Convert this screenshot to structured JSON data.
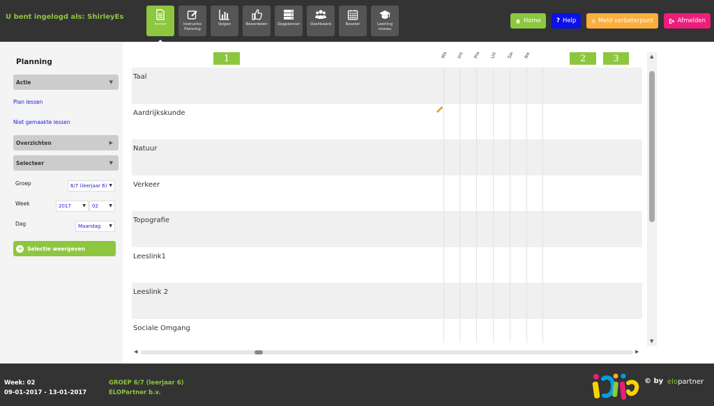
{
  "header": {
    "logged_in": "U bent ingelogd als: ShirleyEs",
    "nav": [
      {
        "label": "Invoer",
        "icon": "file-icon",
        "active": true
      },
      {
        "label": "Instructie Planning",
        "icon": "edit-icon",
        "active": false
      },
      {
        "label": "Volgen",
        "icon": "bar-chart-icon",
        "active": false
      },
      {
        "label": "Beoordelen",
        "icon": "thumbs-up-icon",
        "active": false
      },
      {
        "label": "Dagplanner",
        "icon": "server-icon",
        "active": false
      },
      {
        "label": "Dashboard",
        "icon": "users-icon",
        "active": false
      },
      {
        "label": "Rooster",
        "icon": "calendar-icon",
        "active": false
      },
      {
        "label": "Leerling niveau",
        "icon": "graduation-cap-icon",
        "active": false
      }
    ],
    "buttons": {
      "home": "Home",
      "help": "Help",
      "meld": "Meld verbeterpunt",
      "afmelden": "Afmelden"
    }
  },
  "sidebar": {
    "title": "Planning",
    "actie": "Actie",
    "plan_lessen": "Plan lessen",
    "niet_gemaakte": "Niet gemaakte lessen",
    "overzichten": "Overzichten",
    "selecteer": "Selecteer",
    "groep_label": "Groep",
    "groep_value": "6/7 (leerjaar 6)",
    "week_label": "Week",
    "week_year": "2017",
    "week_number": "02",
    "dag_label": "Dag",
    "dag_value": "Maandag",
    "selectie_btn": "Selectie weergeven"
  },
  "grid": {
    "group_numbers": [
      "1",
      "2",
      "3"
    ],
    "columns": [
      "Mate",
      "Instr.",
      "Plan.",
      "Uitv.",
      "Sam.",
      "Naki."
    ],
    "rows": [
      "Taal",
      "Aardrijkskunde",
      "Natuur",
      "Verkeer",
      "Topografie",
      "Leeslink1",
      "Leeslink 2",
      "Sociale Omgang"
    ]
  },
  "footer": {
    "week": "Week: 02",
    "dates": "09-01-2017 - 13-01-2017",
    "group": "GROEP 6/7 (leerjaar 6)",
    "company": "ELOPartner b.v.",
    "brand": "idijja",
    "by": "© by",
    "elo_prefix": "elo",
    "elo_suffix": "partner"
  },
  "colors": {
    "accent": "#8dc63f",
    "topbar": "#333333",
    "help": "#0a12e6",
    "meld": "#fbae3c",
    "afmelden": "#ec1e79"
  }
}
